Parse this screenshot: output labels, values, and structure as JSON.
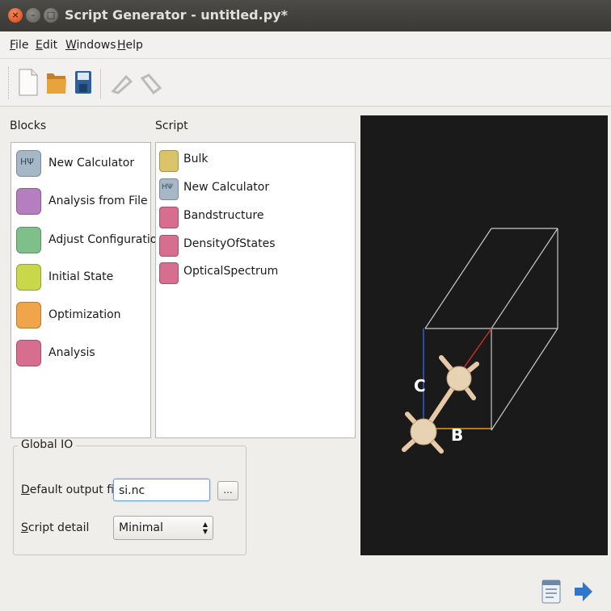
{
  "window": {
    "title": "Script Generator - untitled.py*",
    "close_glyph": "×",
    "min_glyph": "–",
    "max_glyph": "□"
  },
  "menubar": {
    "items": [
      {
        "label": "File",
        "mnemonic": "F",
        "rest": "ile"
      },
      {
        "label": "Edit",
        "mnemonic": "E",
        "rest": "dit"
      },
      {
        "label": "Windows",
        "mnemonic": "W",
        "rest": "indows"
      },
      {
        "label": "Help",
        "mnemonic": "H",
        "rest": "elp"
      }
    ]
  },
  "toolbar": {
    "icons": [
      "new-file-icon",
      "open-folder-icon",
      "save-icon",
      "undo-icon",
      "redo-icon"
    ]
  },
  "blocks": {
    "title": "Blocks",
    "items": [
      {
        "label": "New Calculator",
        "icon": "calculator-icon",
        "icon_text": "HΨ",
        "color": "#a6b8c6"
      },
      {
        "label": "Analysis from File",
        "icon": "file-analysis-icon",
        "color": "#b57fbf"
      },
      {
        "label": "Adjust Configuration",
        "icon": "configuration-icon",
        "color": "#7fc08a"
      },
      {
        "label": "Initial State",
        "icon": "initial-state-icon",
        "color": "#c8d84a"
      },
      {
        "label": "Optimization",
        "icon": "optimization-icon",
        "color": "#f0a54a"
      },
      {
        "label": "Analysis",
        "icon": "analysis-icon",
        "color": "#d76e8f"
      }
    ]
  },
  "script": {
    "title": "Script",
    "items": [
      {
        "label": "Bulk",
        "icon": "bulk-icon",
        "color": "#d9c46a"
      },
      {
        "label": "New Calculator",
        "icon": "calculator-icon",
        "icon_text": "HΨ",
        "color": "#a6b8c6"
      },
      {
        "label": "Bandstructure",
        "icon": "analysis-icon",
        "color": "#d76e8f"
      },
      {
        "label": "DensityOfStates",
        "icon": "analysis-icon",
        "color": "#d76e8f"
      },
      {
        "label": "OpticalSpectrum",
        "icon": "analysis-icon",
        "color": "#d76e8f"
      }
    ]
  },
  "viewer": {
    "axis_c": "C",
    "axis_b": "B",
    "background": "#1a1a1a"
  },
  "global_io": {
    "title": "Global IO",
    "output_label": "Default output file",
    "output_mnemonic": "D",
    "output_rest": "efault output file",
    "output_value": "si.nc",
    "browse_label": "...",
    "detail_label": "Script detail",
    "detail_mnemonic": "S",
    "detail_rest": "cript detail",
    "detail_value": "Minimal"
  },
  "bottom": {
    "icons": [
      "preview-icon",
      "send-arrow-icon"
    ]
  }
}
